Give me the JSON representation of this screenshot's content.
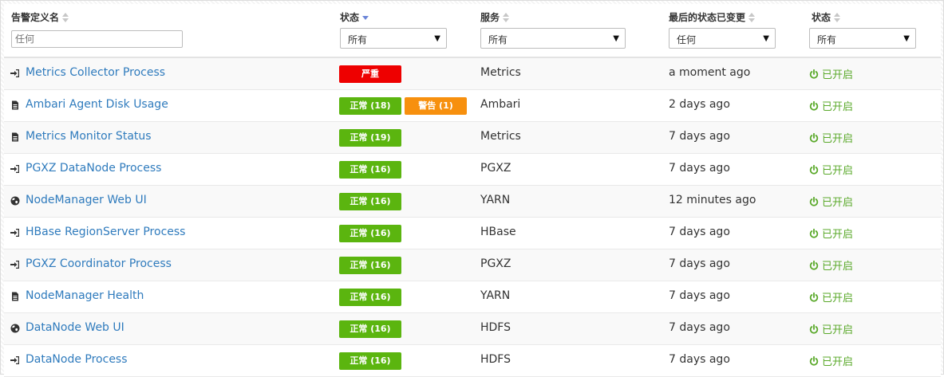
{
  "columns": {
    "name": "告警定义名",
    "status": "状态",
    "service": "服务",
    "last_changed": "最后的状态已变更",
    "state": "状态"
  },
  "filters": {
    "name_placeholder": "任何",
    "status": "所有",
    "service": "所有",
    "last_changed": "任何",
    "state": "所有"
  },
  "accent": {
    "link": "#2f7bbd",
    "critical": "#ee0000",
    "ok": "#5bb50f",
    "warning": "#f7900e",
    "enabled": "#5aa92a"
  },
  "rows": [
    {
      "icon": "sign-in-icon",
      "name": "Metrics Collector Process",
      "badges": [
        {
          "type": "crit",
          "text": "严重"
        }
      ],
      "service": "Metrics",
      "last_changed": "a moment ago",
      "state": "已开启"
    },
    {
      "icon": "file-icon",
      "name": "Ambari Agent Disk Usage",
      "badges": [
        {
          "type": "ok",
          "text": "正常 (18)"
        },
        {
          "type": "warn",
          "text": "警告 (1)"
        }
      ],
      "service": "Ambari",
      "last_changed": "2 days ago",
      "state": "已开启"
    },
    {
      "icon": "file-icon",
      "name": "Metrics Monitor Status",
      "badges": [
        {
          "type": "ok",
          "text": "正常 (19)"
        }
      ],
      "service": "Metrics",
      "last_changed": "7 days ago",
      "state": "已开启"
    },
    {
      "icon": "sign-in-icon",
      "name": "PGXZ DataNode Process",
      "badges": [
        {
          "type": "ok",
          "text": "正常 (16)"
        }
      ],
      "service": "PGXZ",
      "last_changed": "7 days ago",
      "state": "已开启"
    },
    {
      "icon": "globe-icon",
      "name": "NodeManager Web UI",
      "badges": [
        {
          "type": "ok",
          "text": "正常 (16)"
        }
      ],
      "service": "YARN",
      "last_changed": "12 minutes ago",
      "state": "已开启"
    },
    {
      "icon": "sign-in-icon",
      "name": "HBase RegionServer Process",
      "badges": [
        {
          "type": "ok",
          "text": "正常 (16)"
        }
      ],
      "service": "HBase",
      "last_changed": "7 days ago",
      "state": "已开启"
    },
    {
      "icon": "sign-in-icon",
      "name": "PGXZ Coordinator Process",
      "badges": [
        {
          "type": "ok",
          "text": "正常 (16)"
        }
      ],
      "service": "PGXZ",
      "last_changed": "7 days ago",
      "state": "已开启"
    },
    {
      "icon": "file-icon",
      "name": "NodeManager Health",
      "badges": [
        {
          "type": "ok",
          "text": "正常 (16)"
        }
      ],
      "service": "YARN",
      "last_changed": "7 days ago",
      "state": "已开启"
    },
    {
      "icon": "globe-icon",
      "name": "DataNode Web UI",
      "badges": [
        {
          "type": "ok",
          "text": "正常 (16)"
        }
      ],
      "service": "HDFS",
      "last_changed": "7 days ago",
      "state": "已开启"
    },
    {
      "icon": "sign-in-icon",
      "name": "DataNode Process",
      "badges": [
        {
          "type": "ok",
          "text": "正常 (16)"
        }
      ],
      "service": "HDFS",
      "last_changed": "7 days ago",
      "state": "已开启"
    }
  ]
}
